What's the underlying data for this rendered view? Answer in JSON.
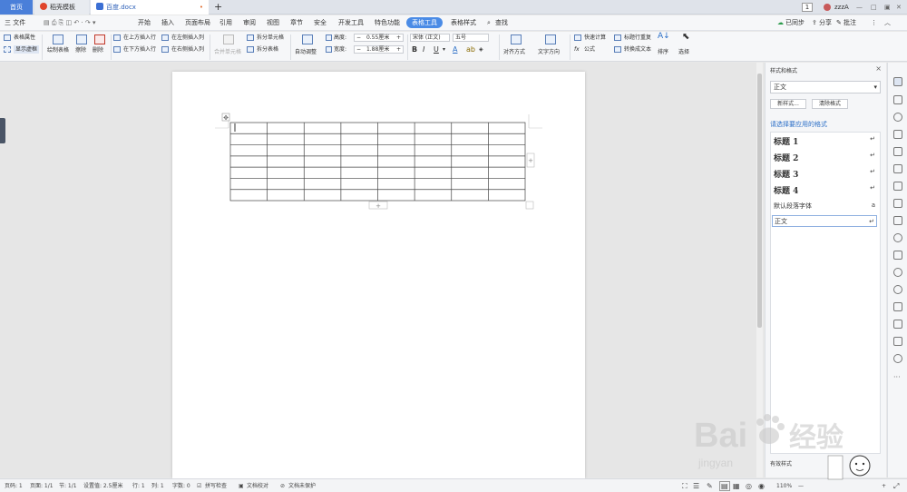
{
  "tabs": {
    "home": "首页",
    "templates": "稻壳模板",
    "doc": "百度.docx",
    "new_tab": "+",
    "page_count": "1",
    "user": "zzzA"
  },
  "menu": {
    "file": "三 文件",
    "items": [
      "开始",
      "插入",
      "页面布局",
      "引用",
      "审阅",
      "视图",
      "章节",
      "安全",
      "开发工具",
      "特色功能",
      "表格工具",
      "表格样式"
    ],
    "active": "表格工具",
    "search": "查找",
    "sync": "已同步",
    "share": "分享",
    "comment": "批注"
  },
  "ribbon": {
    "table_props": "表格属性",
    "show_gridlines": "显示虚框",
    "draw_table": "绘制表格",
    "erase": "擦除",
    "delete": "删除",
    "insert_above": "在上方插入行",
    "insert_below": "在下方插入行",
    "insert_left": "在左侧插入列",
    "insert_right": "在右侧插入列",
    "merge_cells": "合并单元格",
    "split_cells": "拆分单元格",
    "split_table": "拆分表格",
    "auto_adjust": "自动调整",
    "height_label": "高度:",
    "height_value": "0.55厘米",
    "width_label": "宽度:",
    "width_value": "1.88厘米",
    "font_name": "宋体 (正文)",
    "font_size": "五号",
    "align": "对齐方式",
    "text_dir": "文字方向",
    "quick_calc": "快速计算",
    "formula": "公式",
    "repeat_header": "标题行重复",
    "convert_text": "转换成文本",
    "sort": "排序",
    "select": "选择"
  },
  "table": {
    "rows": 7,
    "cols": 8
  },
  "side_panel": {
    "title": "样式和格式",
    "current_style": "正文",
    "new_style": "新样式...",
    "clear_format": "清除格式",
    "hint": "请选择要应用的格式",
    "styles": [
      {
        "label": "标题  1",
        "kind": "heading",
        "mark": "↵"
      },
      {
        "label": "标题  2",
        "kind": "heading",
        "mark": "↵"
      },
      {
        "label": "标题  3",
        "kind": "heading",
        "mark": "↵"
      },
      {
        "label": "标题  4",
        "kind": "heading",
        "mark": "↵"
      },
      {
        "label": "默认段落字体",
        "kind": "plain",
        "mark": "a"
      },
      {
        "label": "正文",
        "kind": "selected",
        "mark": "↵"
      }
    ],
    "bottom_label": "有效样式"
  },
  "status": {
    "page": "页码: 1",
    "pages": "页面: 1/1",
    "section": "节: 1/1",
    "setting": "设置值: 2.5厘米",
    "row": "行: 1",
    "col": "列: 1",
    "words": "字数: 0",
    "spell": "拼写检查",
    "proof": "文档校对",
    "protect": "文档未保护",
    "zoom": "110%"
  },
  "watermark": {
    "brand": "Bai",
    "brand_tail": "经验",
    "url": "jingyan"
  },
  "colors": {
    "accent": "#4a7fd9",
    "active_menu": "#4a8be6",
    "hint": "#2b6fc7"
  }
}
